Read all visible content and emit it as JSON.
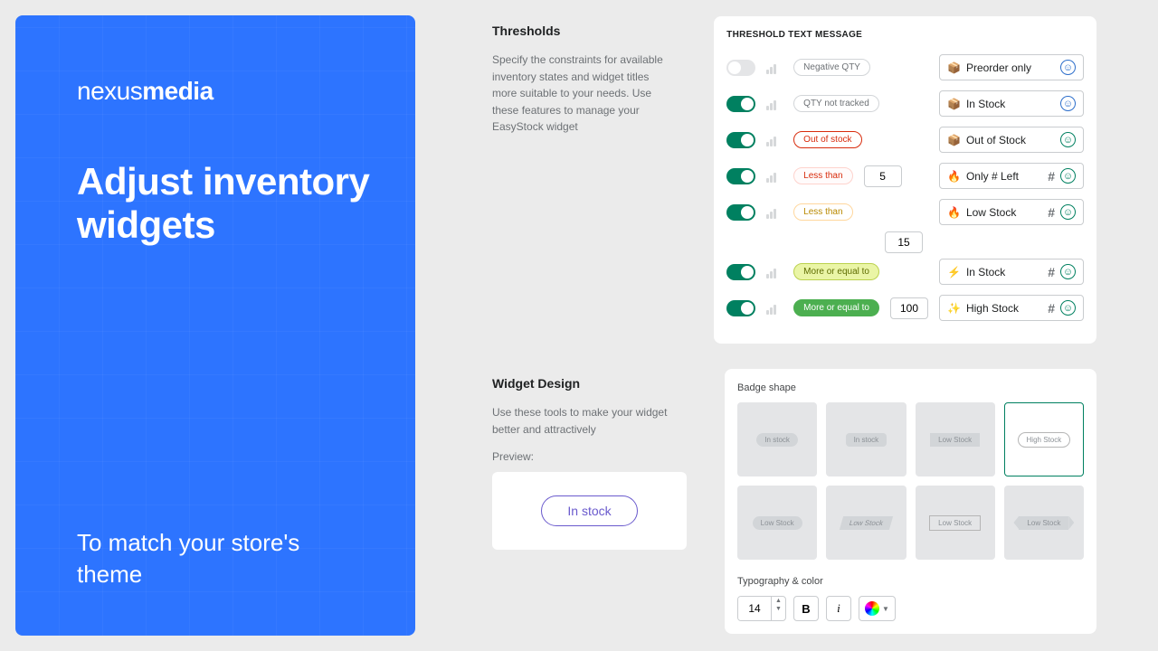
{
  "brand": {
    "prefix": "nexus",
    "bold": "media"
  },
  "hero": {
    "title": "Adjust inventory widgets",
    "footer": "To match your store's theme"
  },
  "thresholds": {
    "title": "Thresholds",
    "desc": "Specify the constraints for available inventory states and widget titles more suitable to your needs. Use these features to manage your EasyStock widget",
    "header": "THRESHOLD TEXT MESSAGE",
    "rows": [
      {
        "on": false,
        "cond": "Negative QTY",
        "condClass": "cond-gray",
        "num": null,
        "emoji": "📦",
        "msg": "Preorder only",
        "hash": false,
        "smile": "blue"
      },
      {
        "on": true,
        "cond": "QTY not tracked",
        "condClass": "cond-gray",
        "num": null,
        "emoji": "📦",
        "msg": "In Stock",
        "hash": false,
        "smile": "blue"
      },
      {
        "on": true,
        "cond": "Out of stock",
        "condClass": "cond-red",
        "num": null,
        "emoji": "📦",
        "msg": "Out of Stock",
        "hash": false,
        "smile": "green"
      },
      {
        "on": true,
        "cond": "Less than",
        "condClass": "cond-red2",
        "num": "5",
        "emoji": "🔥",
        "msg": "Only # Left",
        "hash": true,
        "smile": "green"
      },
      {
        "on": true,
        "cond": "Less than",
        "condClass": "cond-orange",
        "num": "15",
        "numBelow": true,
        "emoji": "🔥",
        "msg": "Low Stock",
        "hash": true,
        "smile": "green"
      },
      {
        "on": true,
        "cond": "More or equal to",
        "condClass": "cond-lime",
        "num": null,
        "emoji": "⚡",
        "msg": "In Stock",
        "hash": true,
        "smile": "green"
      },
      {
        "on": true,
        "cond": "More or equal to",
        "condClass": "cond-green",
        "num": "100",
        "emoji": "✨",
        "msg": "High Stock",
        "hash": true,
        "smile": "green"
      }
    ]
  },
  "design": {
    "title": "Widget Design",
    "desc": "Use these tools to make your widget better and attractively",
    "preview_label": "Preview:",
    "preview_text": "In stock",
    "badge_label": "Badge shape",
    "shapes": [
      {
        "label": "In stock",
        "cls": "sb-round",
        "selected": false
      },
      {
        "label": "In stock",
        "cls": "sb-roundsm",
        "selected": false
      },
      {
        "label": "Low Stock",
        "cls": "sb-rect",
        "selected": false
      },
      {
        "label": "High Stock",
        "cls": "sb-outline",
        "selected": true
      },
      {
        "label": "Low Stock",
        "cls": "sb-round",
        "selected": false
      },
      {
        "label": "Low Stock",
        "cls": "sb-skew",
        "selected": false
      },
      {
        "label": "Low Stock",
        "cls": "sb-bracket",
        "selected": false
      },
      {
        "label": "Low Stock",
        "cls": "sb-ribbon",
        "selected": false
      }
    ],
    "typo_label": "Typography & color",
    "font_size": "14",
    "bold": "B",
    "italic": "i"
  }
}
